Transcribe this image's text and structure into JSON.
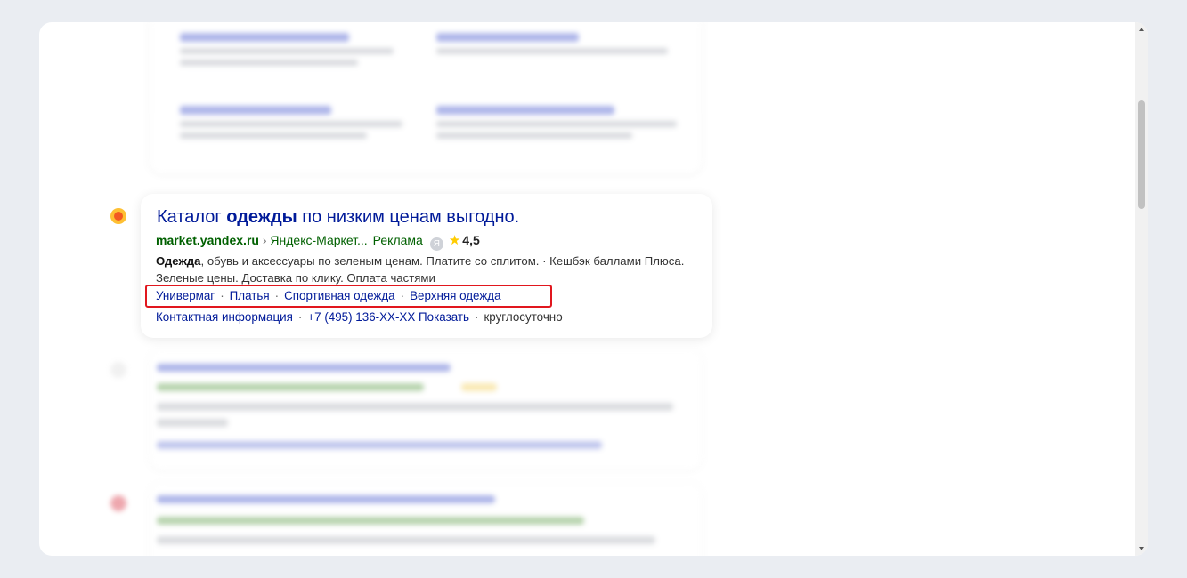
{
  "ad": {
    "title_prefix": "Каталог ",
    "title_bold": "одежды",
    "title_suffix": " по низким ценам выгодно.",
    "domain": "market.yandex.ru",
    "separator": " › ",
    "breadcrumb": "Яндекс-Маркет...",
    "ad_label": "Реклама",
    "badge_letter": "Я",
    "rating": "4,5",
    "description_bold": "Одежда",
    "description_rest": ", обувь и аксессуары по зеленым ценам. Платите со сплитом. · Кешбэк баллами Плюса. Зеленые цены. Доставка по клику. Оплата частями",
    "sitelinks": [
      "Универмаг",
      "Платья",
      "Спортивная одежда",
      "Верхняя одежда"
    ],
    "contact_label": "Контактная информация",
    "phone": "+7 (495) 136-XX-XX",
    "show_label": "Показать",
    "hours": "круглосуточно"
  },
  "colors": {
    "link": "#001a99",
    "green": "#006000",
    "highlight": "#e1171e",
    "star": "#ffcc00"
  }
}
